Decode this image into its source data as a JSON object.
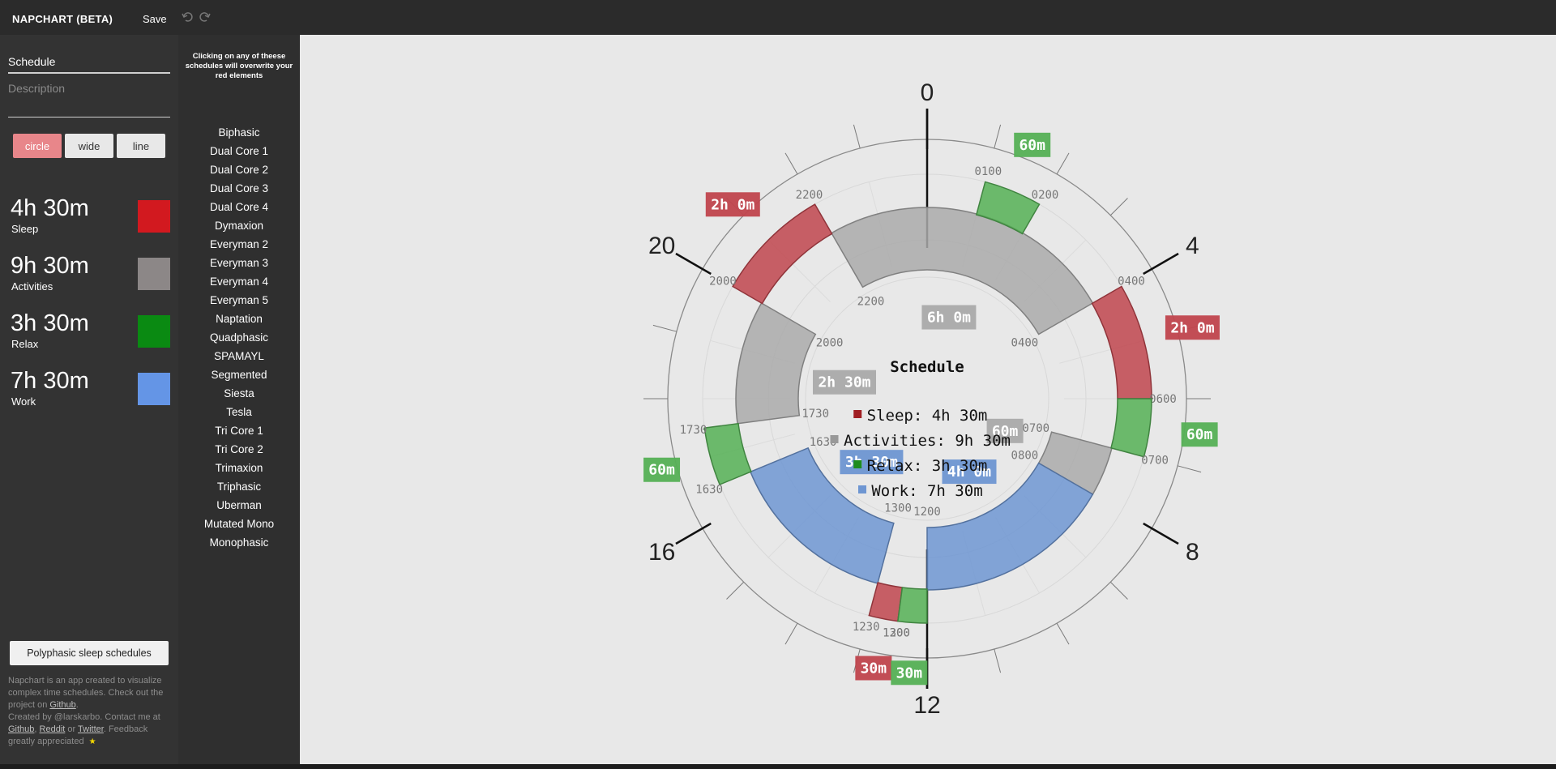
{
  "app": {
    "title": "NAPCHART (BETA)",
    "save_label": "Save"
  },
  "form": {
    "title_value": "Schedule",
    "description_placeholder": "Description"
  },
  "shapes": [
    {
      "label": "circle",
      "active": true
    },
    {
      "label": "wide",
      "active": false
    },
    {
      "label": "line",
      "active": false
    }
  ],
  "categories": [
    {
      "time": "4h 30m",
      "label": "Sleep",
      "color": "#d2191f"
    },
    {
      "time": "9h 30m",
      "label": "Activities",
      "color": "#8c8787"
    },
    {
      "time": "3h 30m",
      "label": "Relax",
      "color": "#0a8a12"
    },
    {
      "time": "7h 30m",
      "label": "Work",
      "color": "#6495e6"
    }
  ],
  "polyphasic_button": "Polyphasic sleep schedules",
  "footer": {
    "line1": "Napchart is an app created to visualize complex time schedules. Check out the project on ",
    "github1": "Github",
    "line1_end": ".",
    "line2": "Created by @larskarbo. Contact me at ",
    "github2": "Github",
    "sep1": ", ",
    "reddit": "Reddit",
    "sep2": " or ",
    "twitter": "Twitter",
    "line2_end": ". Feedback greatly appreciated",
    "star": "★"
  },
  "schedules": {
    "note": "Clicking on any of theese schedules will overwrite your red elements",
    "items": [
      "Biphasic",
      "Dual Core 1",
      "Dual Core 2",
      "Dual Core 3",
      "Dual Core 4",
      "Dymaxion",
      "Everyman 2",
      "Everyman 3",
      "Everyman 4",
      "Everyman 5",
      "Naptation",
      "Quadphasic",
      "SPAMAYL",
      "Segmented",
      "Siesta",
      "Tesla",
      "Tri Core 1",
      "Tri Core 2",
      "Trimaxion",
      "Triphasic",
      "Uberman",
      "Mutated Mono",
      "Monophasic"
    ]
  },
  "chart": {
    "title": "Schedule",
    "hour_labels": [
      "0",
      "4",
      "8",
      "12",
      "16",
      "20"
    ],
    "legend": [
      {
        "text": "Sleep: 4h 30m",
        "color": "#a01e23"
      },
      {
        "text": "Activities: 9h 30m",
        "color": "#999999"
      },
      {
        "text": "Relax: 3h 30m",
        "color": "#1e8c1e"
      },
      {
        "text": "Work: 7h 30m",
        "color": "#6e96d2"
      }
    ],
    "colors": {
      "sleep": "#c0454d",
      "activities": "#aaaaaa",
      "relax": "#55b055",
      "work": "#6e96d2"
    },
    "outer_elements": [
      {
        "category": "sleep",
        "start": "2000",
        "end": "2200",
        "duration": "2h 0m",
        "start_label": "2000",
        "end_label": "2200"
      },
      {
        "category": "relax",
        "start": "0100",
        "end": "0200",
        "duration": "60m",
        "start_label": "0100",
        "end_label": "0200"
      },
      {
        "category": "sleep",
        "start": "0400",
        "end": "0600",
        "duration": "2h 0m",
        "start_label": "0400",
        "end_label": "0600"
      },
      {
        "category": "relax",
        "start": "0600",
        "end": "0700",
        "duration": "60m",
        "start_label": "",
        "end_label": "0700"
      },
      {
        "category": "relax",
        "start": "1630",
        "end": "1730",
        "duration": "60m",
        "start_label": "1630",
        "end_label": "1730"
      },
      {
        "category": "sleep",
        "start": "1230",
        "end": "1300",
        "duration": "30m",
        "start_label": "1300",
        "end_label": "1230"
      },
      {
        "category": "relax",
        "start": "1200",
        "end": "1230",
        "duration": "30m",
        "start_label": "",
        "end_label": "1200"
      }
    ],
    "inner_elements": [
      {
        "category": "activities",
        "start": "2200",
        "end": "0400",
        "duration": "6h 0m",
        "start_label": "2200",
        "end_label": "0400"
      },
      {
        "category": "activities",
        "start": "1730",
        "end": "2000",
        "duration": "2h 30m",
        "start_label": "1730",
        "end_label": "2000"
      },
      {
        "category": "activities",
        "start": "0700",
        "end": "0800",
        "duration": "60m",
        "start_label": "0700",
        "end_label": "0800"
      },
      {
        "category": "work",
        "start": "0800",
        "end": "1200",
        "duration": "4h 0m",
        "start_label": "",
        "end_label": "1200"
      },
      {
        "category": "work",
        "start": "1300",
        "end": "1630",
        "duration": "3h 30m",
        "start_label": "1300",
        "end_label": "1630"
      }
    ]
  }
}
